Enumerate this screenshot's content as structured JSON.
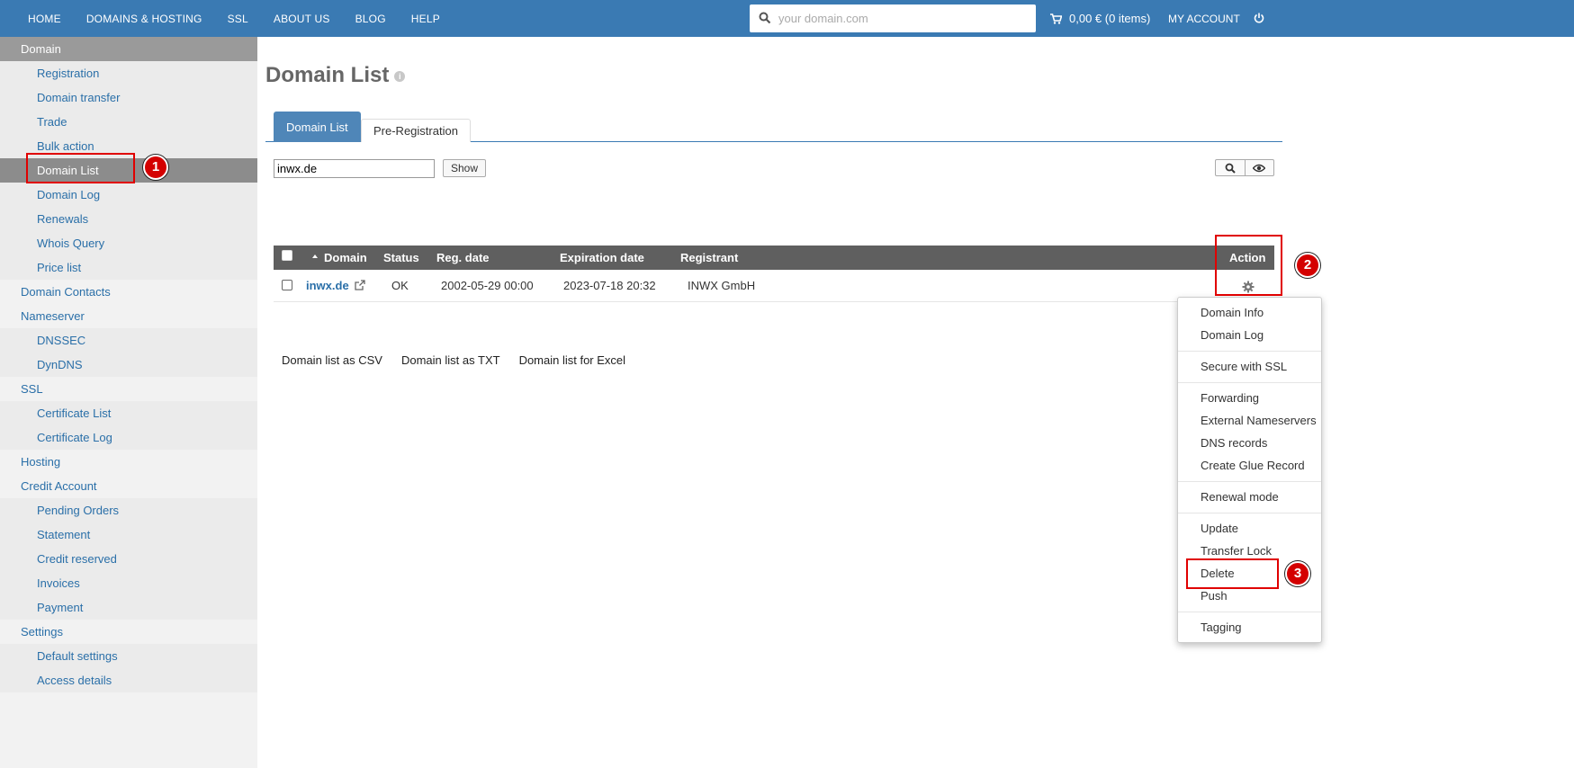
{
  "topnav": {
    "items": [
      "HOME",
      "DOMAINS & HOSTING",
      "SSL",
      "ABOUT US",
      "BLOG",
      "HELP"
    ],
    "search_placeholder": "your domain.com",
    "cart_label": "0,00 € (0 items)",
    "account_label": "MY ACCOUNT"
  },
  "sidebar": {
    "items": [
      {
        "label": "Domain"
      },
      {
        "label": "Registration"
      },
      {
        "label": "Domain transfer"
      },
      {
        "label": "Trade"
      },
      {
        "label": "Bulk action"
      },
      {
        "label": "Domain List"
      },
      {
        "label": "Domain Log"
      },
      {
        "label": "Renewals"
      },
      {
        "label": "Whois Query"
      },
      {
        "label": "Price list"
      },
      {
        "label": "Domain Contacts"
      },
      {
        "label": "Nameserver"
      },
      {
        "label": "DNSSEC"
      },
      {
        "label": "DynDNS"
      },
      {
        "label": "SSL"
      },
      {
        "label": "Certificate List"
      },
      {
        "label": "Certificate Log"
      },
      {
        "label": "Hosting"
      },
      {
        "label": "Credit Account"
      },
      {
        "label": "Pending Orders"
      },
      {
        "label": "Statement"
      },
      {
        "label": "Credit reserved"
      },
      {
        "label": "Invoices"
      },
      {
        "label": "Payment"
      },
      {
        "label": "Settings"
      },
      {
        "label": "Default settings"
      },
      {
        "label": "Access details"
      }
    ]
  },
  "main": {
    "title": "Domain List",
    "tabs": [
      {
        "label": "Domain List"
      },
      {
        "label": "Pre-Registration"
      }
    ],
    "filter_value": "inwx.de",
    "show_label": "Show"
  },
  "table": {
    "columns": [
      "Domain",
      "Status",
      "Reg. date",
      "Expiration date",
      "Registrant",
      "Action"
    ],
    "rows": [
      {
        "domain": "inwx.de",
        "status": "OK",
        "reg_date": "2002-05-29 00:00",
        "exp_date": "2023-07-18 20:32",
        "registrant": "INWX GmbH"
      }
    ]
  },
  "exports": [
    "Domain list as CSV",
    "Domain list as TXT",
    "Domain list for Excel"
  ],
  "action_menu": {
    "items": [
      "Domain Info",
      "Domain Log",
      "Secure with SSL",
      "Forwarding",
      "External Nameservers",
      "DNS records",
      "Create Glue Record",
      "Renewal mode",
      "Update",
      "Transfer Lock",
      "Delete",
      "Push",
      "Tagging"
    ]
  },
  "annotations": [
    "1",
    "2",
    "3"
  ],
  "colors": {
    "nav": "#3a7ab3",
    "link": "#2a6fa8",
    "annotation": "#e00000"
  }
}
